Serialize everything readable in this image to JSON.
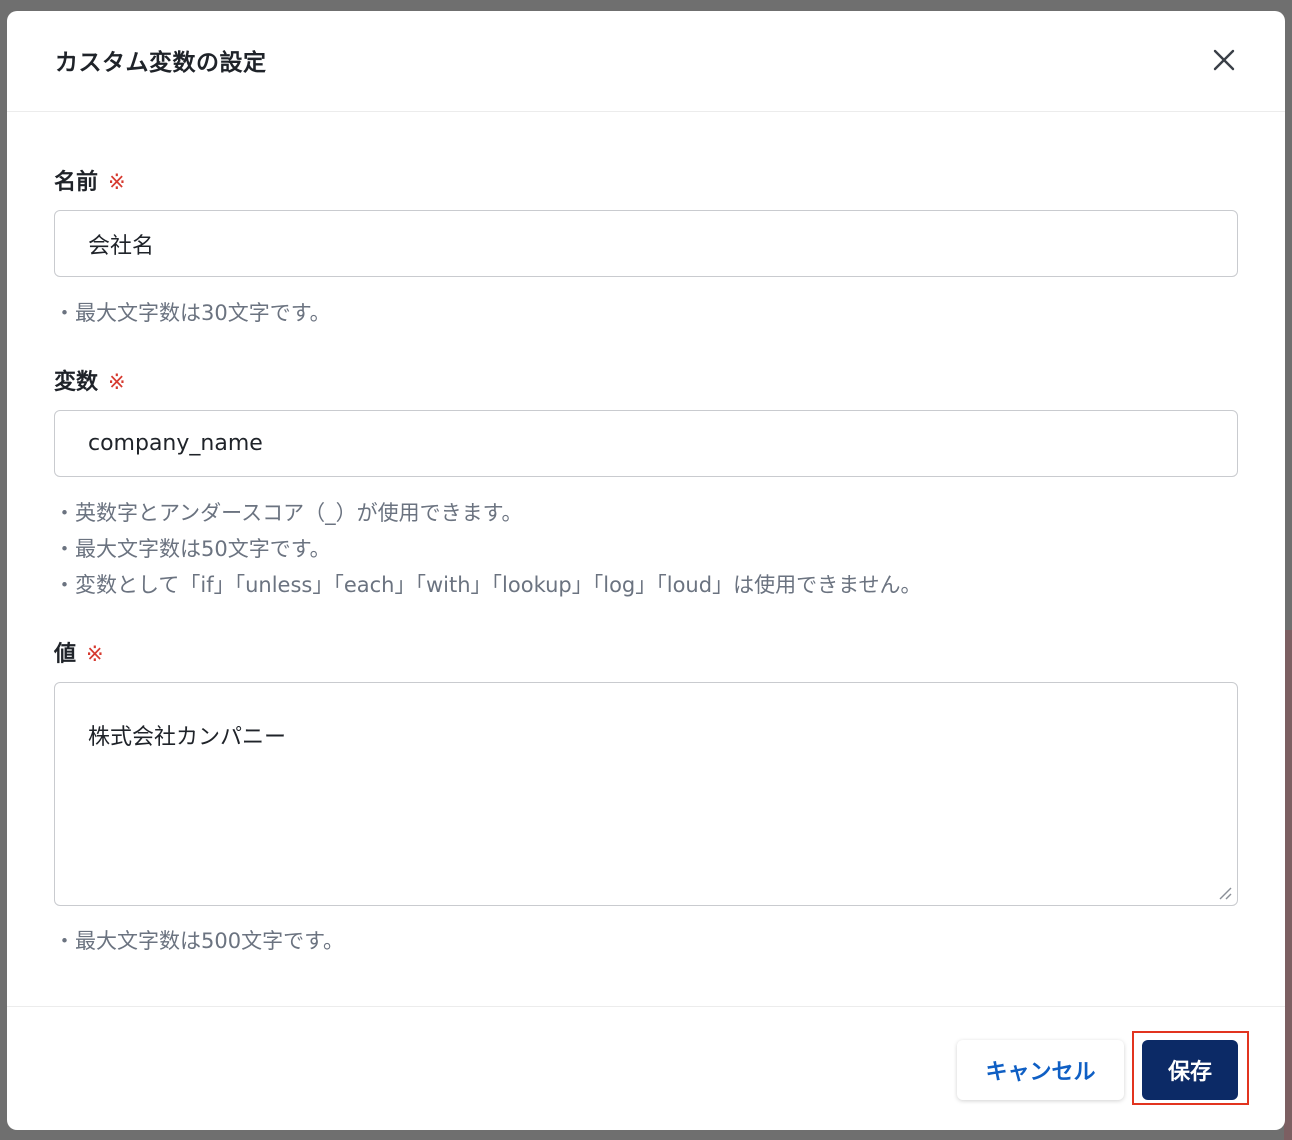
{
  "dialog": {
    "title": "カスタム変数の設定",
    "close_icon": "close-icon"
  },
  "fields": {
    "name": {
      "label": "名前",
      "required_mark": "※",
      "value": "会社名",
      "hints": [
        "・最大文字数は30文字です。"
      ]
    },
    "variable": {
      "label": "変数",
      "required_mark": "※",
      "value": "company_name",
      "hints": [
        "・英数字とアンダースコア（_）が使用できます。",
        "・最大文字数は50文字です。",
        "・変数として「if」「unless」「each」「with」「lookup」「log」「loud」は使用できません。"
      ]
    },
    "value": {
      "label": "値",
      "required_mark": "※",
      "value": "株式会社カンパニー",
      "hints": [
        "・最大文字数は500文字です。"
      ]
    }
  },
  "footer": {
    "cancel_label": "キャンセル",
    "save_label": "保存"
  },
  "colors": {
    "primary": "#0c2a66",
    "link": "#0f5fc4",
    "required": "#d63a2f",
    "highlight": "#e2341f",
    "hint_text": "#6b7380"
  }
}
